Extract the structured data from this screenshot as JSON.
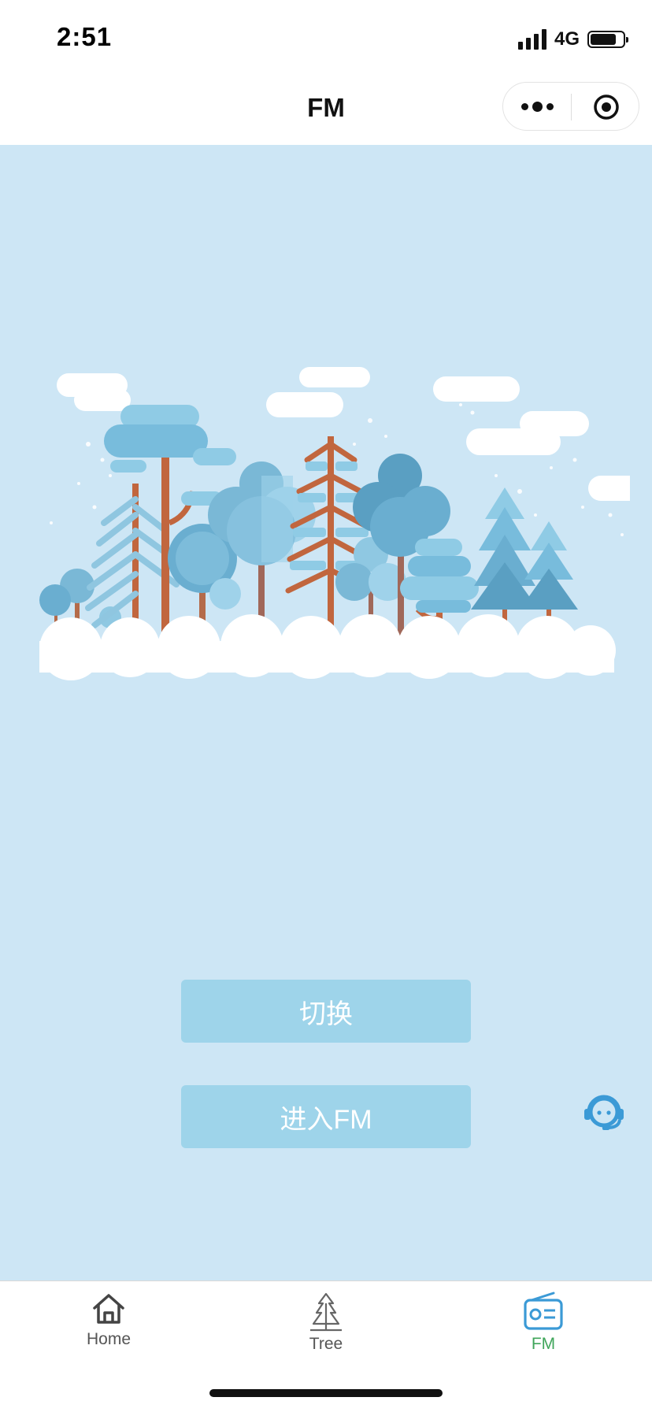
{
  "status_bar": {
    "time": "2:51",
    "network": "4G",
    "battery_level": 0.8
  },
  "nav": {
    "title": "FM"
  },
  "buttons": {
    "switch": "切换",
    "enter_fm": "进入FM"
  },
  "tabs": [
    {
      "label": "Home",
      "icon": "home-icon"
    },
    {
      "label": "Tree",
      "icon": "tree-icon"
    },
    {
      "label": "FM",
      "icon": "radio-icon",
      "active": true
    }
  ],
  "colors": {
    "background": "#cde6f5",
    "button": "#9ed4ea",
    "active_tab": "#3fa55a",
    "icon_blue": "#3b9ad6"
  }
}
